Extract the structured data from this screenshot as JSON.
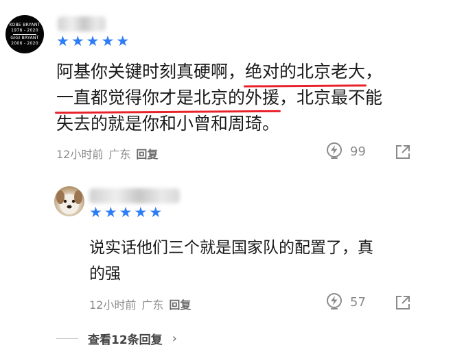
{
  "comment": {
    "avatar": {
      "lines": [
        "KOBE BRYANT",
        "1978 - 2020",
        "GIGI BRYANT",
        "2006 - 2020"
      ]
    },
    "rating": {
      "stars": 5
    },
    "text": {
      "line1_prefix": "阿基你关键时刻真硬啊，",
      "line1_underlined": "绝对的北京老大",
      "line1_suffix": "，",
      "line2_underlined": "一直都觉得你才是北京的外援",
      "line2_suffix": "，北京最不能",
      "line3": "失去的就是你和小曾和周琦。"
    },
    "meta": {
      "time": "12小时前",
      "location": "广东",
      "reply_label": "回复"
    },
    "likes": "99"
  },
  "reply": {
    "rating": {
      "stars": 5
    },
    "text": {
      "line1": "说实话他们三个就是国家队的配置了，真",
      "line2": "的强"
    },
    "meta": {
      "time": "12小时前",
      "location": "广东",
      "reply_label": "回复"
    },
    "likes": "57"
  },
  "more_replies": {
    "label": "查看12条回复",
    "chevron": "›"
  },
  "colors": {
    "star": "#2f7df6",
    "underline": "#e8222a",
    "meta": "#8a8a8a"
  },
  "icons": [
    "lightning-like-icon",
    "share-icon",
    "chevron-right-icon"
  ]
}
